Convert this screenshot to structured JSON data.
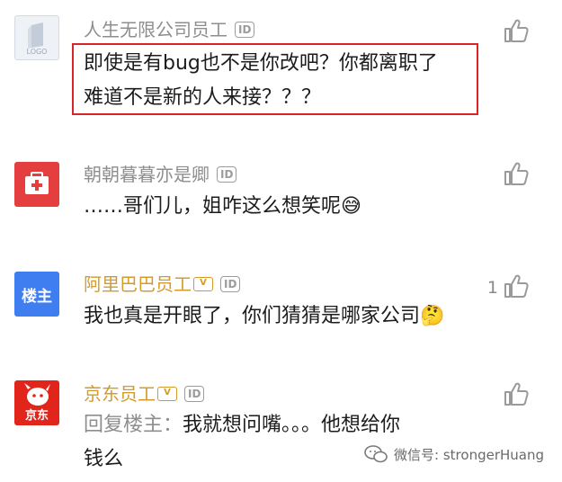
{
  "comments": [
    {
      "username": "人生无限公司员工",
      "id_badge": "ID",
      "lines": [
        "即使是有bug也不是你改吧？你都离职了",
        "难道不是新的人来接？？？"
      ],
      "avatar": {
        "type": "logo",
        "label": "LOGO"
      }
    },
    {
      "username": "朝朝暮暮亦是卿",
      "id_badge": "ID",
      "lines": [
        "……哥们儿，姐咋这么想笑呢😅"
      ],
      "avatar": {
        "type": "medkit"
      }
    },
    {
      "username": "阿里巴巴员工",
      "id_badge": "ID",
      "vip_label": "V",
      "lines": [
        "我也真是开眼了，你们猜猜是哪家公司🤔"
      ],
      "avatar": {
        "type": "text",
        "label": "楼主"
      },
      "like_count": "1"
    },
    {
      "username": "京东员工",
      "id_badge": "ID",
      "vip_label": "V",
      "reply_prefix": "回复楼主：",
      "lines": [
        "我就想问嘴。。。他想给你",
        "钱么"
      ],
      "avatar": {
        "type": "jd",
        "label": "京东"
      }
    }
  ],
  "watermark": {
    "text": "微信号: strongerHuang"
  },
  "colors": {
    "highlight_border": "#d9242a",
    "gold": "#d49b28",
    "avatar_blue": "#3e7ef0",
    "avatar_red": "#e43e3e"
  }
}
